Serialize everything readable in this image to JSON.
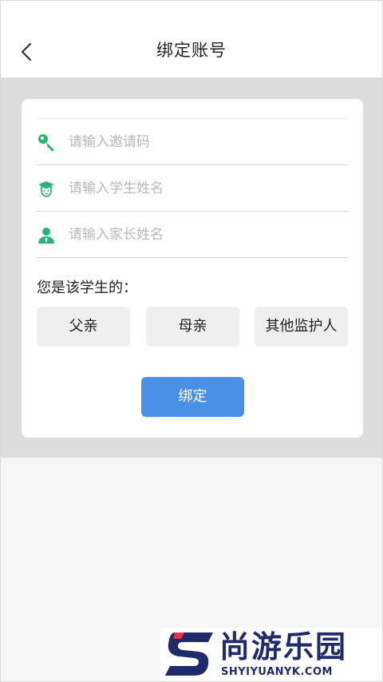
{
  "header": {
    "title": "绑定账号"
  },
  "form": {
    "fields": [
      {
        "placeholder": "请输入邀请码",
        "value": "",
        "icon": "key-icon"
      },
      {
        "placeholder": "请输入学生姓名",
        "value": "",
        "icon": "student-icon"
      },
      {
        "placeholder": "请输入家长姓名",
        "value": "",
        "icon": "parent-icon"
      }
    ],
    "relation_label": "您是该学生的：",
    "relation_options": [
      "父亲",
      "母亲",
      "其他监护人"
    ],
    "submit_label": "绑定"
  },
  "watermark": {
    "text": "尚游乐园",
    "url": "SHYIYUANYK.COM"
  },
  "colors": {
    "accent": "#4a90e6",
    "icon_green": "#2bb37a",
    "band_gray": "#dcdcdc",
    "brand_navy": "#1f2a6b",
    "brand_red": "#e8324a"
  }
}
